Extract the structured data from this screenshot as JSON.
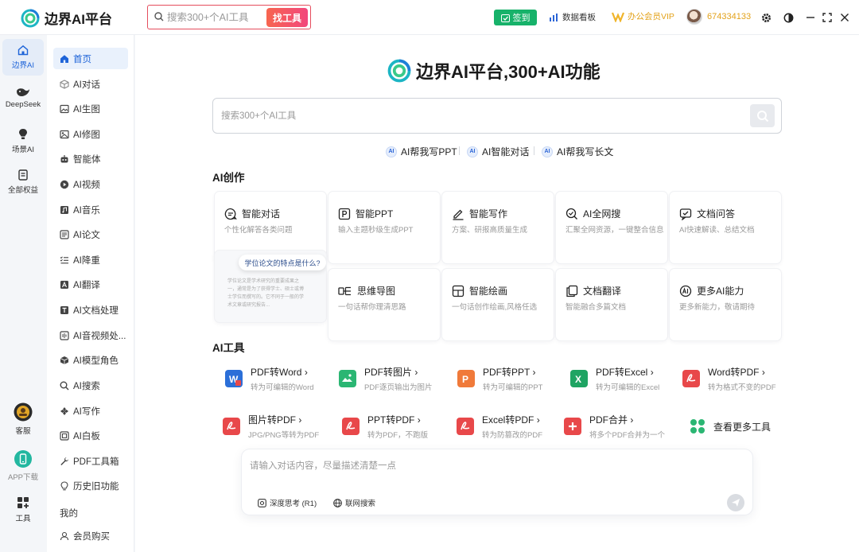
{
  "app": {
    "name": "边界AI平台"
  },
  "top_search": {
    "placeholder": "搜索300+个AI工具",
    "button": "找工具"
  },
  "topbar": {
    "signin": "签到",
    "dashboard": "数据看板",
    "vip": "办公会员VIP",
    "user_id": "674334133"
  },
  "rail": [
    {
      "label": "边界AI",
      "icon": "home-icon",
      "active": true
    },
    {
      "label": "DeepSeek",
      "icon": "whale-icon"
    },
    {
      "label": "场景AI",
      "icon": "bulb-icon"
    },
    {
      "label": "全部权益",
      "icon": "bookmark-icon"
    },
    {
      "label": "客服",
      "icon": "support-avatar-icon"
    },
    {
      "label": "APP下载",
      "icon": "phone-icon"
    },
    {
      "label": "工具",
      "icon": "tools-grid-icon"
    }
  ],
  "nav": {
    "items": [
      {
        "label": "首页",
        "icon": "home-icon",
        "active": true
      },
      {
        "label": "AI对话",
        "icon": "cube-icon"
      },
      {
        "label": "AI生图",
        "icon": "image-icon"
      },
      {
        "label": "AI修图",
        "icon": "photo-edit-icon"
      },
      {
        "label": "智能体",
        "icon": "robot-icon"
      },
      {
        "label": "AI视频",
        "icon": "play-icon"
      },
      {
        "label": "AI音乐",
        "icon": "music-icon"
      },
      {
        "label": "AI论文",
        "icon": "paper-icon"
      },
      {
        "label": "AI降重",
        "icon": "list-icon"
      },
      {
        "label": "AI翻译",
        "icon": "translate-icon"
      },
      {
        "label": "AI文档处理",
        "icon": "doc-icon"
      },
      {
        "label": "AI音视频处...",
        "icon": "media-icon"
      },
      {
        "label": "AI模型角色",
        "icon": "model-icon"
      },
      {
        "label": "AI搜索",
        "icon": "search-icon"
      },
      {
        "label": "AI写作",
        "icon": "write-icon"
      },
      {
        "label": "AI白板",
        "icon": "whiteboard-icon"
      },
      {
        "label": "PDF工具箱",
        "icon": "wrench-icon"
      },
      {
        "label": "历史旧功能",
        "icon": "bulb-icon"
      }
    ],
    "mine_title": "我的",
    "member_item": "会员购买"
  },
  "hero": {
    "title": "边界AI平台,300+AI功能"
  },
  "main_search": {
    "placeholder": "搜索300+个AI工具"
  },
  "quick_links": [
    "AI帮我写PPT",
    "AI智能对话",
    "AI帮我写长文"
  ],
  "sections": {
    "create": "AI创作",
    "tools": "AI工具"
  },
  "create_cards": [
    {
      "title": "智能对话",
      "desc": "个性化解答各类问题",
      "icon": "chat-icon"
    },
    {
      "title": "智能PPT",
      "desc": "输入主题秒级生成PPT",
      "icon": "ppt-icon"
    },
    {
      "title": "智能写作",
      "desc": "方案、研报高质量生成",
      "icon": "pen-icon"
    },
    {
      "title": "AI全网搜",
      "desc": "汇聚全网资源，一键整合信息",
      "icon": "web-search-icon"
    },
    {
      "title": "文档问答",
      "desc": "AI快速解读、总结文档",
      "icon": "doc-qa-icon"
    },
    {
      "title": "思维导图",
      "desc": "一句话帮你理清思路",
      "icon": "mindmap-icon"
    },
    {
      "title": "智能绘画",
      "desc": "一句话创作绘画,风格任选",
      "icon": "paint-icon"
    },
    {
      "title": "文档翻译",
      "desc": "智能融合多篇文档",
      "icon": "doc-translate-icon"
    },
    {
      "title": "更多AI能力",
      "desc": "更多新能力，敬请期待",
      "icon": "more-ai-icon"
    }
  ],
  "promo": {
    "question": "学位论文的特点是什么?",
    "answer": "学位论文是学术研究的重要成果之一，通常是为了获得学士、硕士或博士学位而撰写的。它不同于一般的学术文章或研究报告..."
  },
  "tools": [
    {
      "title": "PDF转Word",
      "desc": "转为可编辑的Word",
      "icon": "pdf-to-word-icon",
      "color": "#2b6fd8"
    },
    {
      "title": "PDF转图片",
      "desc": "PDF逐页输出为图片",
      "icon": "pdf-to-image-icon",
      "color": "#2bb673"
    },
    {
      "title": "PDF转PPT",
      "desc": "转为可编辑的PPT",
      "icon": "pdf-to-ppt-icon",
      "color": "#f07a3a"
    },
    {
      "title": "PDF转Excel",
      "desc": "转为可编辑的Excel",
      "icon": "pdf-to-excel-icon",
      "color": "#1fa463"
    },
    {
      "title": "Word转PDF",
      "desc": "转为格式不变的PDF",
      "icon": "word-to-pdf-icon",
      "color": "#e8484a"
    },
    {
      "title": "图片转PDF",
      "desc": "JPG/PNG等转为PDF",
      "icon": "image-to-pdf-icon",
      "color": "#e8484a"
    },
    {
      "title": "PPT转PDF",
      "desc": "转为PDF，不跑版",
      "icon": "ppt-to-pdf-icon",
      "color": "#e8484a"
    },
    {
      "title": "Excel转PDF",
      "desc": "转为防篡改的PDF",
      "icon": "excel-to-pdf-icon",
      "color": "#e8484a"
    },
    {
      "title": "PDF合并",
      "desc": "将多个PDF合并为一个",
      "icon": "pdf-merge-icon",
      "color": "#e8484a"
    }
  ],
  "more_tools": "查看更多工具",
  "chat": {
    "placeholder": "请输入对话内容，尽量描述清楚一点",
    "deep_think": "深度思考 (R1)",
    "web_search": "联网搜索"
  },
  "colors": {
    "accent": "#1e64d8",
    "brand_teal": "#1cb5c4",
    "signin": "#17b26a",
    "vip": "#e3a21a",
    "find_button": "#f2477d"
  }
}
